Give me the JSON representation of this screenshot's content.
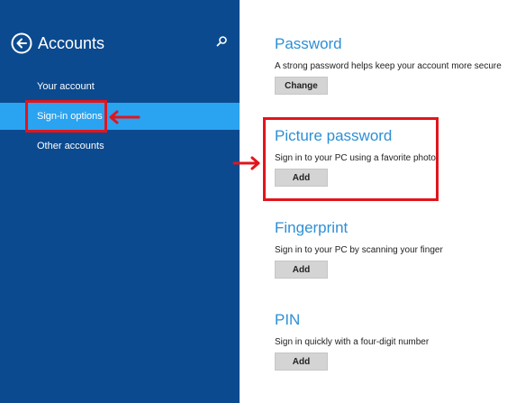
{
  "sidebar": {
    "title": "Accounts",
    "back_icon": "back-arrow-circle-icon",
    "search_icon": "search-icon",
    "items": [
      {
        "label": "Your account",
        "selected": false
      },
      {
        "label": "Sign-in options",
        "selected": true
      },
      {
        "label": "Other accounts",
        "selected": false
      }
    ],
    "background_color": "#0b4a8f",
    "selected_color": "#2aa3f0"
  },
  "main": {
    "sections": [
      {
        "title": "Password",
        "description": "A strong password helps keep your account more secure",
        "button_label": "Change"
      },
      {
        "title": "Picture password",
        "description": "Sign in to your PC using a favorite photo",
        "button_label": "Add"
      },
      {
        "title": "Fingerprint",
        "description": "Sign in to your PC by scanning your finger",
        "button_label": "Add"
      },
      {
        "title": "PIN",
        "description": "Sign in quickly with a four-digit number",
        "button_label": "Add"
      }
    ],
    "accent_color": "#2d8fd5"
  },
  "annotations": {
    "highlight_color": "#e3141c",
    "arrow_icon": "red-arrow-icon"
  }
}
